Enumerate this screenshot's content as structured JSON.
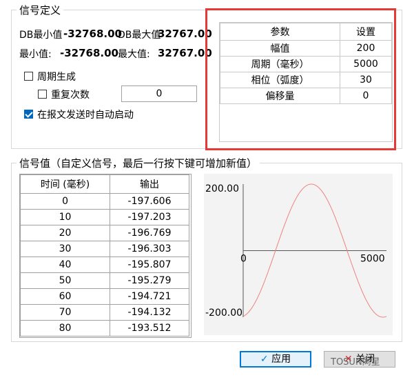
{
  "signal_def": {
    "title": "信号定义",
    "db_min_label": "DB最小值",
    "db_min_value": "-32768.00",
    "db_max_label": "DB最大值",
    "db_max_value": "32767.00",
    "min_label": "最小值:",
    "min_value": "-32768.00",
    "max_label": "最大值:",
    "max_value": "32767.00",
    "periodic_label": "周期生成",
    "repeat_label": "重复次数",
    "repeat_value": "0",
    "autostart_label": "在报文发送时自动启动"
  },
  "param_table": {
    "headers": [
      "参数",
      "设置"
    ],
    "rows": [
      [
        "幅值",
        "200"
      ],
      [
        "周期（毫秒）",
        "5000"
      ],
      [
        "相位（弧度）",
        "30"
      ],
      [
        "偏移量",
        "0"
      ]
    ]
  },
  "signal_values": {
    "title": "信号值（自定义信号，最后一行按下键可增加新值）",
    "headers": [
      "时间 (毫秒)",
      "输出"
    ],
    "rows": [
      [
        "0",
        "-197.606"
      ],
      [
        "10",
        "-197.203"
      ],
      [
        "20",
        "-196.769"
      ],
      [
        "30",
        "-196.303"
      ],
      [
        "40",
        "-195.807"
      ],
      [
        "50",
        "-195.279"
      ],
      [
        "60",
        "-194.721"
      ],
      [
        "70",
        "-194.132"
      ],
      [
        "80",
        "-193.512"
      ]
    ]
  },
  "chart_data": {
    "type": "line",
    "y_max_label": "200.00",
    "y_min_label": "-200.00",
    "x_start_label": "0",
    "x_end_label": "5000",
    "ylim": [
      -200,
      200
    ],
    "xlim": [
      0,
      5000
    ],
    "amplitude": 200,
    "period_ms": 5000,
    "start_value": -197.606,
    "line_color": "#f08080"
  },
  "buttons": {
    "apply": "应用",
    "close": "关闭"
  },
  "watermark": "TOSUN同星",
  "colors": {
    "highlight_border": "#e53935",
    "accent": "#0078d7"
  }
}
